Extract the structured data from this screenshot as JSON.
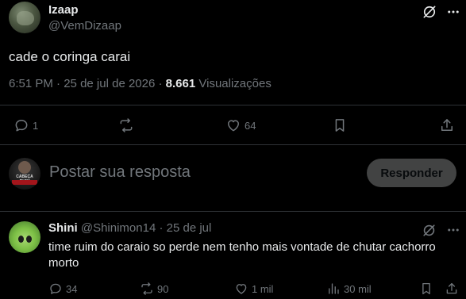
{
  "post": {
    "author_name": "Izaap",
    "author_handle": "@VemDizaap",
    "text": "cade o coringa carai",
    "time": "6:51 PM",
    "separator": "·",
    "date": "25 de jul de 2026",
    "views_count": "8.661",
    "views_label": "Visualizações",
    "actions": {
      "replies": "1",
      "reposts": "",
      "likes": "64"
    }
  },
  "composer": {
    "placeholder": "Postar sua resposta",
    "submit_label": "Responder",
    "avatar_text": "CABEÇA RUIM"
  },
  "reply": {
    "author_name": "Shini",
    "author_handle": "@Shinimon14",
    "separator": "·",
    "date": "25 de jul",
    "text": "time ruim do caraio so perde nem tenho mais vontade de chutar cachorro morto",
    "actions": {
      "replies": "34",
      "reposts": "90",
      "likes": "1 mil",
      "views": "30 mil"
    }
  },
  "colors": {
    "background": "#000000",
    "text": "#e7e9ea",
    "muted": "#71767b",
    "divider": "#2f3336",
    "button_bg": "#787a7a"
  }
}
